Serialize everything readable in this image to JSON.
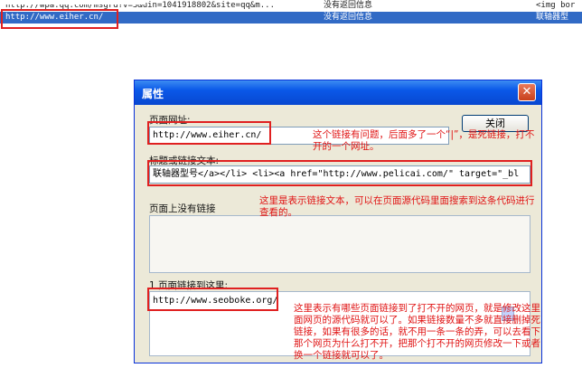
{
  "list": {
    "rows": [
      {
        "url": "http://wpa.qq.com/msgrd?v=3&uin=1041918802&site=qq&m...",
        "status": "没有返回信息",
        "anchor": "<img bor"
      },
      {
        "url": "http://www.eiher.cn/",
        "status": "没有返回信息",
        "anchor": "联轴器型"
      }
    ]
  },
  "dialog": {
    "title": "属性",
    "close_glyph": "✕",
    "page_url_label": "页面网址:",
    "page_url_value": "http://www.eiher.cn/",
    "close_button": "关闭",
    "anchor_label": "标题或链接文本:",
    "anchor_value": "联轴器型号</a></li> <li><a href=\"http://www.pelicai.com/\" target=\"_bl",
    "no_link_label": "页面上没有链接",
    "linked_label": "1 页面链接到这里:",
    "linked_value": "http://www.seoboke.org/"
  },
  "notes": {
    "note1_line1": "这个链接有问题，后面多了一个“|”，是死链接，打不",
    "note1_line2": "开的一个网址。",
    "note2_line1": "这里是表示链接文本，可以在页面源代码里面搜索到这条代码进行",
    "note2_line2": "查看的。",
    "note3_line1": "这里表示有哪些页面链接到了打不开的网页，就是修改这里",
    "note3_line2": "面网页的源代码就可以了。如果链接数量不多就直接删掉死",
    "note3_line3": "链接，如果有很多的话，就不用一条一条的弄，可以去看下",
    "note3_line4": "那个网页为什么打不开，把那个打不开的网页修改一下或者",
    "note3_line5": "换一个链接就可以了。"
  },
  "colors": {
    "selection": "#316ac5",
    "annotation": "#e02020",
    "titlebar": "#0a58e8"
  }
}
